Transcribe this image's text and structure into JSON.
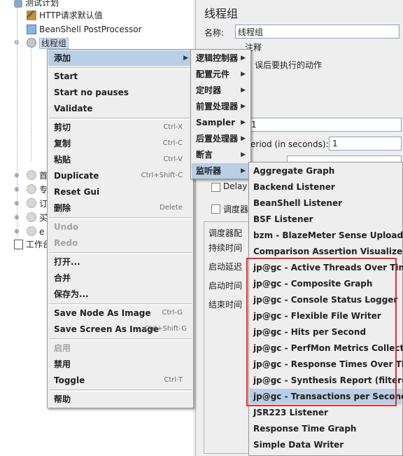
{
  "tree": {
    "items": [
      {
        "label": "测试计划"
      },
      {
        "label": "HTTP请求默认值"
      },
      {
        "label": "BeanShell PostProcessor"
      },
      {
        "label": "线程组"
      },
      {
        "label": "首"
      },
      {
        "label": "专"
      },
      {
        "label": "订"
      },
      {
        "label": "买"
      },
      {
        "label": "e"
      },
      {
        "label": "工作台"
      }
    ]
  },
  "panel": {
    "title": "线程组",
    "name_label": "名称:",
    "name_value": "线程组",
    "comment_peek": "注释",
    "error_action_peek": "误后要执行的动作",
    "threads_value_peek": "1",
    "rampup_label_peek": "eriod (in seconds):",
    "rampup_value": "1",
    "delay_label": "Delay",
    "scheduler_label": "调度器",
    "scheduler_section": "调度器配",
    "duration_label": "持续时间",
    "startup_delay_label": "启动延迟",
    "start_time_label": "启动时间",
    "end_time_label": "结束时间"
  },
  "context_menu": {
    "items": [
      {
        "label": "添加",
        "shortcut": "",
        "submenu": true,
        "disabled": false
      },
      {
        "label": "Start",
        "shortcut": "",
        "disabled": false
      },
      {
        "label": "Start no pauses",
        "shortcut": "",
        "disabled": false
      },
      {
        "label": "Validate",
        "shortcut": "",
        "disabled": false
      },
      {
        "label": "剪切",
        "shortcut": "Ctrl-X",
        "disabled": false
      },
      {
        "label": "复制",
        "shortcut": "Ctrl-C",
        "disabled": false
      },
      {
        "label": "粘贴",
        "shortcut": "Ctrl-V",
        "disabled": false
      },
      {
        "label": "Duplicate",
        "shortcut": "Ctrl+Shift-C",
        "disabled": false
      },
      {
        "label": "Reset Gui",
        "shortcut": "",
        "disabled": false
      },
      {
        "label": "删除",
        "shortcut": "Delete",
        "disabled": false
      },
      {
        "label": "Undo",
        "shortcut": "",
        "disabled": true
      },
      {
        "label": "Redo",
        "shortcut": "",
        "disabled": true
      },
      {
        "label": "打开...",
        "shortcut": "",
        "disabled": false
      },
      {
        "label": "合并",
        "shortcut": "",
        "disabled": false
      },
      {
        "label": "保存为...",
        "shortcut": "",
        "disabled": false
      },
      {
        "label": "Save Node As Image",
        "shortcut": "Ctrl-G",
        "disabled": false
      },
      {
        "label": "Save Screen As Image",
        "shortcut": "Ctrl+Shift-G",
        "disabled": false
      },
      {
        "label": "启用",
        "shortcut": "",
        "disabled": true
      },
      {
        "label": "禁用",
        "shortcut": "",
        "disabled": false
      },
      {
        "label": "Toggle",
        "shortcut": "Ctrl-T",
        "disabled": false
      },
      {
        "label": "帮助",
        "shortcut": "",
        "disabled": false
      }
    ]
  },
  "add_menu": {
    "items": [
      {
        "label": "逻辑控制器"
      },
      {
        "label": "配置元件"
      },
      {
        "label": "定时器"
      },
      {
        "label": "前置处理器"
      },
      {
        "label": "Sampler"
      },
      {
        "label": "后置处理器"
      },
      {
        "label": "断言"
      },
      {
        "label": "监听器"
      }
    ]
  },
  "listener_menu": {
    "items": [
      {
        "label": "Aggregate Graph"
      },
      {
        "label": "Backend Listener"
      },
      {
        "label": "BeanShell Listener"
      },
      {
        "label": "BSF Listener"
      },
      {
        "label": "bzm - BlazeMeter Sense Uploader"
      },
      {
        "label": "Comparison Assertion Visualizer"
      },
      {
        "label": "jp@gc - Active Threads Over Time"
      },
      {
        "label": "jp@gc - Composite Graph"
      },
      {
        "label": "jp@gc - Console Status Logger"
      },
      {
        "label": "jp@gc - Flexible File Writer"
      },
      {
        "label": "jp@gc - Hits per Second"
      },
      {
        "label": "jp@gc - PerfMon Metrics Collector"
      },
      {
        "label": "jp@gc - Response Times Over Time"
      },
      {
        "label": "jp@gc - Synthesis Report (filtered)"
      },
      {
        "label": "jp@gc - Transactions per Second"
      },
      {
        "label": "JSR223 Listener"
      },
      {
        "label": "Response Time Graph"
      },
      {
        "label": "Simple Data Writer"
      }
    ]
  },
  "colors": {
    "menu_highlight": "#b8cfe5",
    "annotation_box": "#e0302f"
  }
}
